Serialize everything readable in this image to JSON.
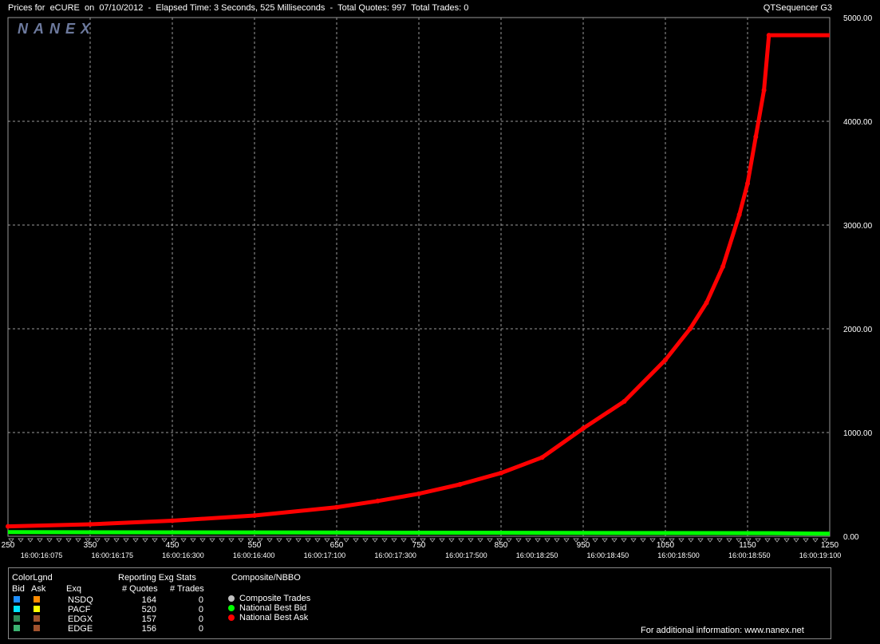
{
  "header": {
    "title": "Prices for  eCURE  on  07/10/2012  -  Elapsed Time: 3 Seconds, 525 Milliseconds  -  Total Quotes: 997  Total Trades: 0",
    "app": "QTSequencer G3",
    "logo": "NANEX"
  },
  "chart_data": {
    "type": "line",
    "xlim": [
      250,
      1250
    ],
    "ylim": [
      0,
      5000
    ],
    "x_ticks": [
      "250",
      "350",
      "450",
      "550",
      "650",
      "750",
      "850",
      "950",
      "1050",
      "1150",
      "1250"
    ],
    "y_ticks": [
      "0.00",
      "1000.00",
      "2000.00",
      "3000.00",
      "4000.00",
      "5000.00"
    ],
    "time_labels": [
      "16:00:16:075",
      "16:00:16:175",
      "16:00:16:300",
      "16:00:16:400",
      "16:00:17:100",
      "16:00:17:300",
      "16:00:17:500",
      "16:00:18:250",
      "16:00:18:450",
      "16:00:18:500",
      "16:00:18:550",
      "16:00:19:100"
    ],
    "grid": true,
    "series": [
      {
        "name": "National Best Ask",
        "color": "#ff0000",
        "x": [
          250,
          350,
          450,
          550,
          650,
          700,
          750,
          800,
          850,
          900,
          950,
          1000,
          1050,
          1080,
          1100,
          1120,
          1140,
          1150,
          1160,
          1170,
          1176,
          1250
        ],
        "y": [
          95,
          115,
          150,
          200,
          280,
          340,
          410,
          500,
          610,
          760,
          1040,
          1300,
          1700,
          2000,
          2250,
          2600,
          3100,
          3400,
          3850,
          4300,
          4830,
          4830
        ]
      },
      {
        "name": "National Best Bid",
        "color": "#00ff00",
        "x": [
          250,
          1180,
          1250
        ],
        "y": [
          40,
          30,
          25
        ]
      }
    ]
  },
  "legend": {
    "colorlgnd_label": "ColorLgnd",
    "bid_label": "Bid",
    "ask_label": "Ask",
    "exq_label": "Exq",
    "stats_title": "Reporting Exg Stats",
    "quotes_label": "# Quotes",
    "trades_label": "# Trades",
    "composite_title": "Composite/NBBO",
    "rows": [
      {
        "exq": "NSDQ",
        "quotes": "164",
        "trades": "0",
        "bid_color": "#1e90ff",
        "ask_color": "#ff8c00"
      },
      {
        "exq": "PACF",
        "quotes": "520",
        "trades": "0",
        "bid_color": "#00e5ff",
        "ask_color": "#ffff00"
      },
      {
        "exq": "EDGX",
        "quotes": "157",
        "trades": "0",
        "bid_color": "#2e8b57",
        "ask_color": "#a0522d"
      },
      {
        "exq": "EDGE",
        "quotes": "156",
        "trades": "0",
        "bid_color": "#3cb371",
        "ask_color": "#a0522d"
      }
    ],
    "composite": [
      {
        "label": "Composite Trades",
        "color": "#c0c0c0"
      },
      {
        "label": "National Best Bid",
        "color": "#00ff00"
      },
      {
        "label": "National Best Ask",
        "color": "#ff0000"
      }
    ],
    "footer": "For additional information: www.nanex.net"
  }
}
